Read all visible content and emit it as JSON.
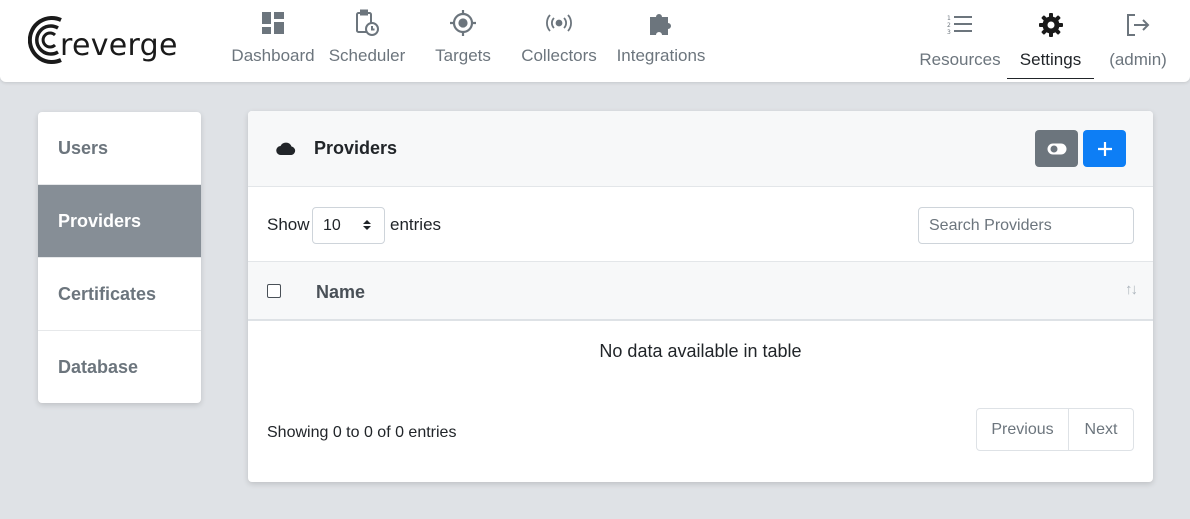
{
  "brand": {
    "name": "reverge"
  },
  "nav": {
    "items": [
      {
        "label": "Dashboard",
        "icon": "dashboard-icon"
      },
      {
        "label": "Scheduler",
        "icon": "scheduler-icon"
      },
      {
        "label": "Targets",
        "icon": "target-icon"
      },
      {
        "label": "Collectors",
        "icon": "broadcast-icon"
      },
      {
        "label": "Integrations",
        "icon": "puzzle-icon"
      }
    ],
    "right": [
      {
        "label": "Resources",
        "icon": "list-ordered-icon"
      },
      {
        "label": "Settings",
        "icon": "gear-icon",
        "active": true
      },
      {
        "label": "(admin)",
        "icon": "logout-icon"
      }
    ]
  },
  "sidebar": {
    "items": [
      {
        "label": "Users"
      },
      {
        "label": "Providers",
        "active": true
      },
      {
        "label": "Certificates"
      },
      {
        "label": "Database"
      }
    ]
  },
  "card": {
    "title": "Providers",
    "icon": "cloud-icon",
    "toggle_icon": "toggle-icon",
    "add_icon": "plus-icon"
  },
  "table": {
    "show_label": "Show",
    "entries_label": "entries",
    "length_value": "10",
    "search_placeholder": "Search Providers",
    "columns": [
      "Name"
    ],
    "empty_message": "No data available in table",
    "info": "Showing 0 to 0 of 0 entries",
    "pagination": {
      "previous": "Previous",
      "next": "Next"
    }
  },
  "colors": {
    "accent": "#0d7ef5",
    "secondary": "#6c757d",
    "sidebar_active": "#868e96",
    "background": "#dfe2e6"
  }
}
